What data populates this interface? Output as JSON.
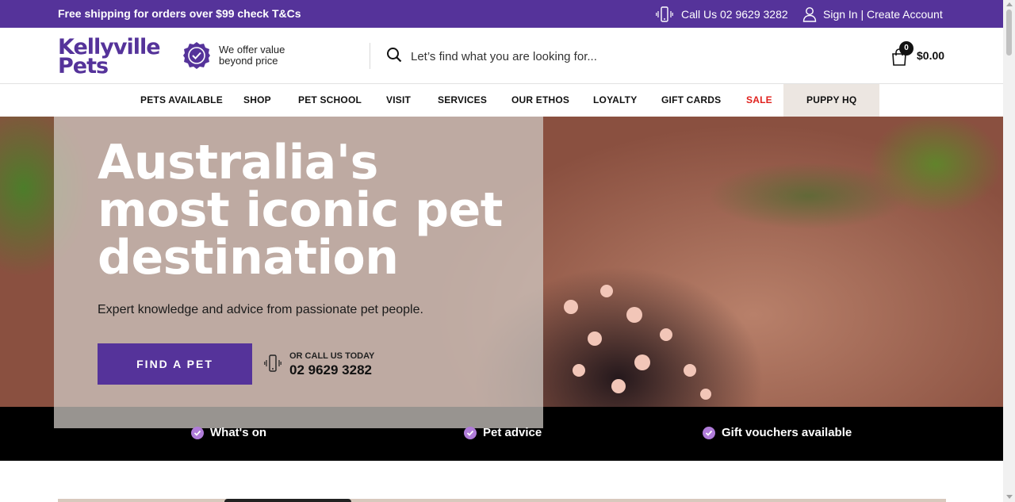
{
  "topbar": {
    "promo": "Free shipping for orders over $99 check T&Cs",
    "call_label": "Call Us 02 9629 3282",
    "call_icon": "mobile-phone-icon",
    "account_label": "Sign In | Create Account",
    "account_icon": "user-icon"
  },
  "header": {
    "logo_line1": "Kellyville",
    "logo_line2": "Pets",
    "value_text": "We offer value beyond price",
    "value_icon": "check-badge-icon",
    "search_placeholder": "Let’s find what you are looking for...",
    "search_icon": "search-icon",
    "cart_count": "0",
    "cart_total": "$0.00",
    "cart_icon": "shopping-bag-icon"
  },
  "nav": {
    "items": [
      {
        "label": "PETS AVAILABLE"
      },
      {
        "label": "SHOP"
      },
      {
        "label": "PET SCHOOL"
      },
      {
        "label": "VISIT"
      },
      {
        "label": "SERVICES"
      },
      {
        "label": "OUR ETHOS"
      },
      {
        "label": "LOYALTY"
      },
      {
        "label": "GIFT CARDS"
      },
      {
        "label": "SALE"
      },
      {
        "label": "PUPPY HQ"
      }
    ]
  },
  "hero": {
    "title": "Australia's most iconic pet destination",
    "subtitle": "Expert knowledge and advice from passionate pet people.",
    "cta": "FIND A PET",
    "call_label": "OR CALL US TODAY",
    "call_number": "02 9629 3282"
  },
  "features": [
    {
      "label": "What's on"
    },
    {
      "label": "Pet advice"
    },
    {
      "label": "Gift vouchers available"
    }
  ],
  "colors": {
    "brand_purple": "#55339a",
    "sale_red": "#e0211d",
    "check_lilac": "#b07cd9"
  }
}
